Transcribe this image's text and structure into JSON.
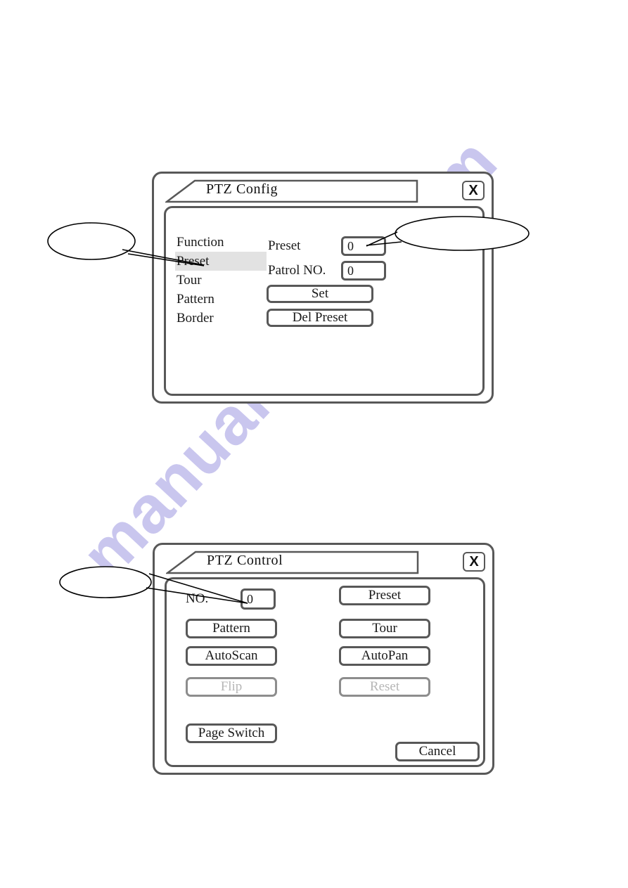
{
  "page": {
    "background_color": "#ffffff",
    "watermark_text": "manualshive.com",
    "watermark_color": "#c9c6ee"
  },
  "ptz_config": {
    "title": "PTZ Config",
    "close_label": "X",
    "close_icon": "close-icon",
    "menu": {
      "items": [
        {
          "label": "Function",
          "selected": false
        },
        {
          "label": "Preset",
          "selected": true
        },
        {
          "label": "Tour",
          "selected": false
        },
        {
          "label": "Pattern",
          "selected": false
        },
        {
          "label": "Border",
          "selected": false
        }
      ],
      "selected_label": "Preset",
      "highlight_color": "#e2e2e2"
    },
    "fields": [
      {
        "label": "Preset",
        "value": "0"
      },
      {
        "label": "Patrol NO.",
        "value": "0"
      }
    ],
    "buttons": [
      {
        "label": "Set",
        "disabled": false
      },
      {
        "label": "Del Preset",
        "disabled": false
      }
    ]
  },
  "ptz_control": {
    "title": "PTZ Control",
    "close_label": "X",
    "close_icon": "close-icon",
    "no_field": {
      "label": "NO.",
      "value": "0"
    },
    "buttons_left": [
      {
        "label": "Pattern",
        "disabled": false
      },
      {
        "label": "AutoScan",
        "disabled": false
      },
      {
        "label": "Flip",
        "disabled": true
      }
    ],
    "buttons_right": [
      {
        "label": "Preset",
        "disabled": false
      },
      {
        "label": "Tour",
        "disabled": false
      },
      {
        "label": "AutoPan",
        "disabled": false
      },
      {
        "label": "Reset",
        "disabled": true
      }
    ],
    "page_switch_label": "Page Switch",
    "cancel_label": "Cancel"
  },
  "callouts": [
    {
      "name": "callout-preset-menu",
      "text": "",
      "points_to": "Preset menu item"
    },
    {
      "name": "callout-preset-value",
      "text": "",
      "points_to": "Preset value input"
    },
    {
      "name": "callout-no-value",
      "text": "",
      "points_to": "NO. value input"
    }
  ]
}
